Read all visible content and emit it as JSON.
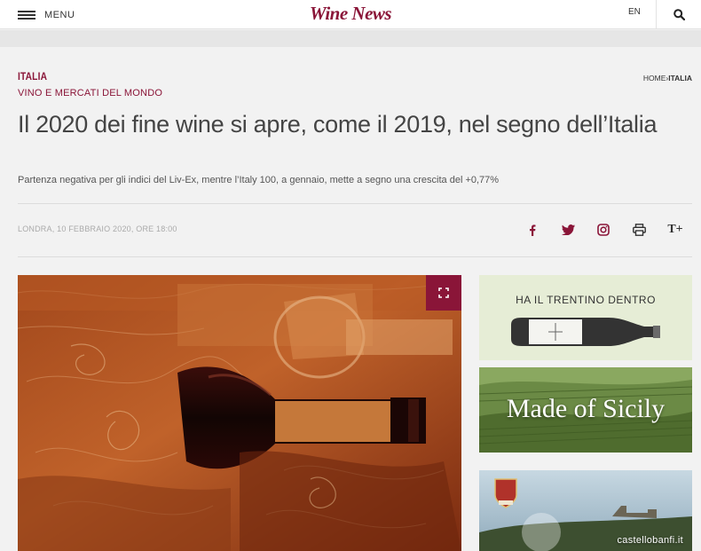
{
  "header": {
    "menu_label": "MENU",
    "logo_text": "Wine News",
    "lang": "EN"
  },
  "breadcrumb": {
    "home": "HOME",
    "separator": "›",
    "current": "ITALIA"
  },
  "article": {
    "section": "ITALIA",
    "subsection": "VINO E MERCATI DEL MONDO",
    "title": "Il 2020 dei fine wine si apre, come il 2019, nel segno dell’Italia",
    "subtitle": "Partenza negativa per gli indici del Liv-Ex, mentre l’Italy 100, a gennaio, mette a segno una crescita del +0,77%",
    "dateline": "LONDRA, 10 FEBBRAIO 2020, ORE 18:00"
  },
  "share": {
    "icons": [
      "facebook-icon",
      "twitter-icon",
      "instagram-icon",
      "print-icon",
      "text-size-icon"
    ],
    "text_size_glyph": "T+"
  },
  "ads": {
    "ad1_text": "HA IL TRENTINO DENTRO",
    "ad2_text": "Made of Sicily",
    "ad3_text": "castellobanfi.it"
  },
  "colors": {
    "accent": "#8a1538",
    "background": "#f2f2f2"
  }
}
